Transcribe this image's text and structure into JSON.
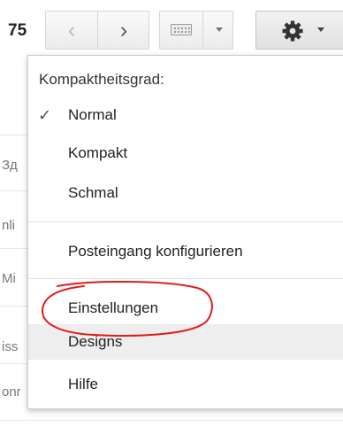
{
  "toolbar": {
    "count": "75",
    "prev_icon": "‹",
    "next_icon": "›",
    "keyboard_icon": "keyboard-icon",
    "settings_icon": "gear-icon"
  },
  "background_rows": [
    "Зд",
    "nli",
    "Mi",
    "iss",
    "onr"
  ],
  "menu": {
    "heading": "Kompaktheitsgrad:",
    "density": [
      {
        "label": "Normal",
        "checked": true
      },
      {
        "label": "Kompakt",
        "checked": false
      },
      {
        "label": "Schmal",
        "checked": false
      }
    ],
    "configure_inbox": "Posteingang konfigurieren",
    "settings": "Einstellungen",
    "themes": "Designs",
    "help": "Hilfe",
    "check_glyph": "✓"
  },
  "colors": {
    "annotation": "#e21b1b",
    "hover_background": "#eeeeee"
  }
}
